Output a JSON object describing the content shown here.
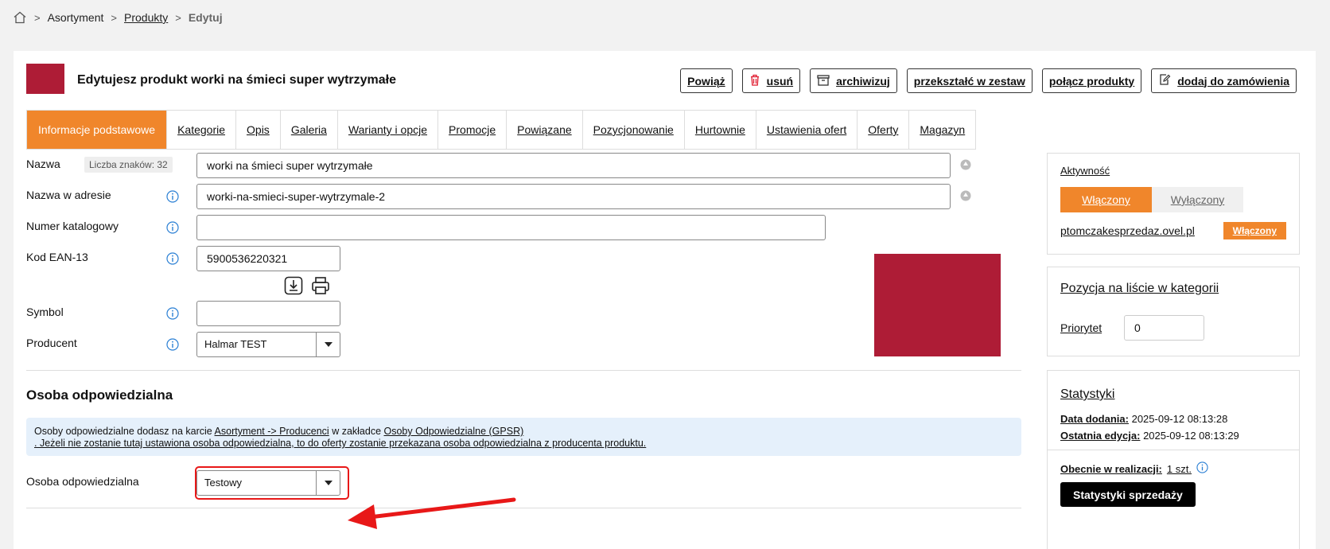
{
  "breadcrumb": {
    "items": [
      "Asortyment",
      "Produkty"
    ],
    "current": "Edytuj"
  },
  "header": {
    "title": "Edytujesz produkt worki na śmieci super wytrzymałe",
    "thumb_color": "#ae1c36",
    "actions": {
      "link": "Powiąż",
      "delete": "usuń",
      "archive": "archiwizuj",
      "convert": "przekształć w zestaw",
      "merge": "połącz produkty",
      "add_order": "dodaj do zamówienia"
    }
  },
  "tabs": [
    "Informacje podstawowe",
    "Kategorie",
    "Opis",
    "Galeria",
    "Warianty i opcje",
    "Promocje",
    "Powiązane",
    "Pozycjonowanie",
    "Hurtownie",
    "Ustawienia ofert",
    "Oferty",
    "Magazyn"
  ],
  "form": {
    "name": {
      "label": "Nazwa",
      "char_count": "Liczba znaków: 32",
      "value": "worki na śmieci super wytrzymałe"
    },
    "slug": {
      "label": "Nazwa w adresie",
      "value": "worki-na-smieci-super-wytrzymale-2"
    },
    "catalog": {
      "label": "Numer katalogowy",
      "value": ""
    },
    "ean": {
      "label": "Kod EAN-13",
      "value": "5900536220321"
    },
    "symbol": {
      "label": "Symbol",
      "value": ""
    },
    "producer": {
      "label": "Producent",
      "value": "Halmar TEST"
    }
  },
  "responsible": {
    "title": "Osoba odpowiedzialna",
    "info_prefix": "Osoby odpowiedzialne dodasz na karcie ",
    "info_link1": "Asortyment -> Producenci",
    "info_mid": " w zakładce ",
    "info_link2": "Osoby Odpowiedzialne (GPSR)",
    "info_line2": ". Jeżeli nie zostanie tutaj ustawiona osoba odpowiedzialna, to do oferty zostanie przekazana osoba odpowiedzialna z producenta produktu.",
    "label": "Osoba odpowiedzialna",
    "value": "Testowy"
  },
  "sidebar": {
    "activity": {
      "title": "Aktywność",
      "on": "Włączony",
      "off": "Wyłączony",
      "shop": "ptomczakesprzedaz.ovel.pl",
      "shop_status": "Włączony"
    },
    "position": {
      "title": "Pozycja na liście w kategorii",
      "priority_label": "Priorytet",
      "priority_value": "0"
    },
    "stats": {
      "title": "Statystyki",
      "added_label": "Data dodania:",
      "added_value": "2025-09-12 08:13:28",
      "edited_label": "Ostatnia edycja:",
      "edited_value": "2025-09-12 08:13:29",
      "realization_label": "Obecnie w realizacji:",
      "realization_value": "1 szt.",
      "sales_button": "Statystyki sprzedaży"
    }
  },
  "colors": {
    "accent": "#f0862b",
    "product": "#ae1c36",
    "highlight": "#e81818",
    "info_bg": "#e5f0fb"
  }
}
